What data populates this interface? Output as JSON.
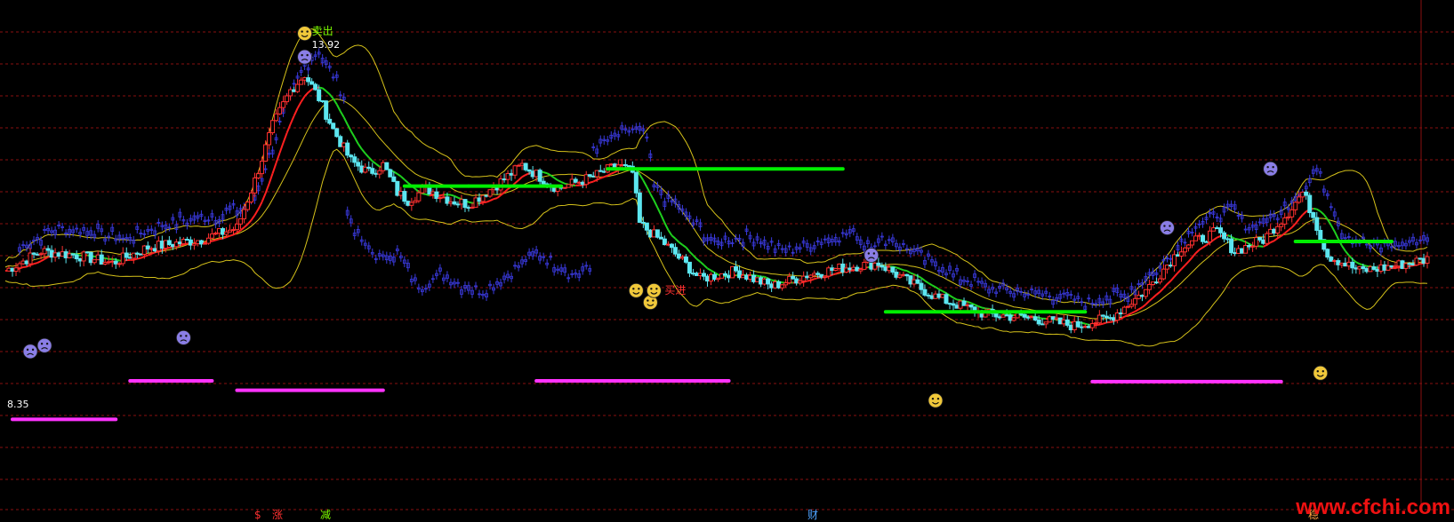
{
  "header": {
    "title": "",
    "legend_text": ""
  },
  "watermark": "www.cfchi.com",
  "chart_data": {
    "type": "candlestick",
    "title": "",
    "price_range": [
      2.5,
      15.5
    ],
    "grid": "horizontal dashed red",
    "annotations": {
      "high_label": "13.92",
      "low_label": "8.35",
      "buy_label": "买进",
      "sell_label": "卖出"
    },
    "bottom_markers": [
      {
        "text": "$",
        "color": "#ff3030"
      },
      {
        "text": "涨",
        "color": "#ff3030"
      },
      {
        "text": "减",
        "color": "#7cfc00"
      },
      {
        "text": "财",
        "color": "#4fa3ff"
      },
      {
        "text": "稳",
        "color": "#ffa040"
      }
    ],
    "levels": [
      {
        "from": 2,
        "to": 31,
        "value": 4.82,
        "color": "#ff33ff"
      },
      {
        "from": 35,
        "to": 58,
        "value": 5.8,
        "color": "#ff33ff"
      },
      {
        "from": 65,
        "to": 106,
        "value": 5.56,
        "color": "#ff33ff"
      },
      {
        "from": 149,
        "to": 203,
        "value": 5.8,
        "color": "#ff33ff"
      },
      {
        "from": 112,
        "to": 130,
        "value": 10.76,
        "color": "#00ee00"
      },
      {
        "from": 130,
        "to": 156,
        "value": 10.76,
        "color": "#00ee00"
      },
      {
        "from": 169,
        "to": 235,
        "value": 11.2,
        "color": "#00ee00"
      },
      {
        "from": 247,
        "to": 303,
        "value": 7.56,
        "color": "#00ee00"
      },
      {
        "from": 362,
        "to": 389,
        "value": 9.35,
        "color": "#00ee00"
      },
      {
        "from": 305,
        "to": 358,
        "value": 5.78,
        "color": "#ff33ff"
      }
    ],
    "emoji_markers": [
      {
        "i": 7,
        "price": 6.55,
        "kind": "sad"
      },
      {
        "i": 11,
        "price": 6.7,
        "kind": "sad"
      },
      {
        "i": 50,
        "price": 6.9,
        "kind": "sad"
      },
      {
        "i": 84,
        "price": 14.05,
        "kind": "sad"
      },
      {
        "i": 84,
        "price": 14.65,
        "kind": "happy"
      },
      {
        "i": 177,
        "price": 8.1,
        "kind": "happy"
      },
      {
        "i": 181,
        "price": 7.8,
        "kind": "happy"
      },
      {
        "i": 182,
        "price": 8.1,
        "kind": "happy"
      },
      {
        "i": 243,
        "price": 9.0,
        "kind": "sad"
      },
      {
        "i": 261,
        "price": 5.3,
        "kind": "happy"
      },
      {
        "i": 326,
        "price": 9.7,
        "kind": "sad"
      },
      {
        "i": 355,
        "price": 11.2,
        "kind": "sad"
      },
      {
        "i": 369,
        "price": 6.0,
        "kind": "happy"
      }
    ]
  }
}
